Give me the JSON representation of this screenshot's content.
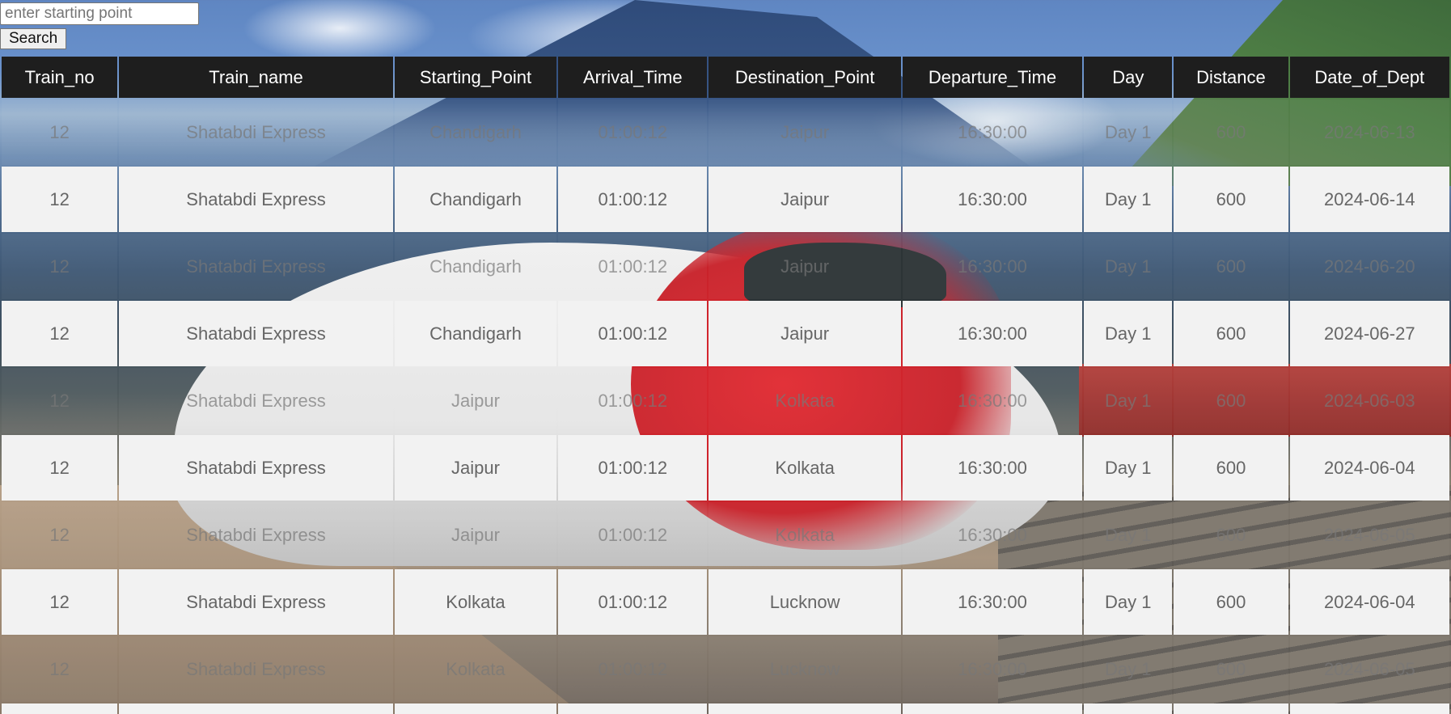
{
  "search": {
    "placeholder": "enter starting point",
    "value": "",
    "button_label": "Search"
  },
  "table": {
    "headers": [
      "Train_no",
      "Train_name",
      "Starting_Point",
      "Arrival_Time",
      "Destination_Point",
      "Departure_Time",
      "Day",
      "Distance",
      "Date_of_Dept"
    ],
    "rows": [
      [
        "12",
        "Shatabdi Express",
        "Chandigarh",
        "01:00:12",
        "Jaipur",
        "16:30:00",
        "Day 1",
        "600",
        "2024-06-13"
      ],
      [
        "12",
        "Shatabdi Express",
        "Chandigarh",
        "01:00:12",
        "Jaipur",
        "16:30:00",
        "Day 1",
        "600",
        "2024-06-14"
      ],
      [
        "12",
        "Shatabdi Express",
        "Chandigarh",
        "01:00:12",
        "Jaipur",
        "16:30:00",
        "Day 1",
        "600",
        "2024-06-20"
      ],
      [
        "12",
        "Shatabdi Express",
        "Chandigarh",
        "01:00:12",
        "Jaipur",
        "16:30:00",
        "Day 1",
        "600",
        "2024-06-27"
      ],
      [
        "12",
        "Shatabdi Express",
        "Jaipur",
        "01:00:12",
        "Kolkata",
        "16:30:00",
        "Day 1",
        "600",
        "2024-06-03"
      ],
      [
        "12",
        "Shatabdi Express",
        "Jaipur",
        "01:00:12",
        "Kolkata",
        "16:30:00",
        "Day 1",
        "600",
        "2024-06-04"
      ],
      [
        "12",
        "Shatabdi Express",
        "Jaipur",
        "01:00:12",
        "Kolkata",
        "16:30:00",
        "Day 1",
        "600",
        "2024-06-05"
      ],
      [
        "12",
        "Shatabdi Express",
        "Kolkata",
        "01:00:12",
        "Lucknow",
        "16:30:00",
        "Day 1",
        "600",
        "2024-06-04"
      ],
      [
        "12",
        "Shatabdi Express",
        "Kolkata",
        "01:00:12",
        "Lucknow",
        "16:30:00",
        "Day 1",
        "600",
        "2024-06-05"
      ]
    ]
  }
}
